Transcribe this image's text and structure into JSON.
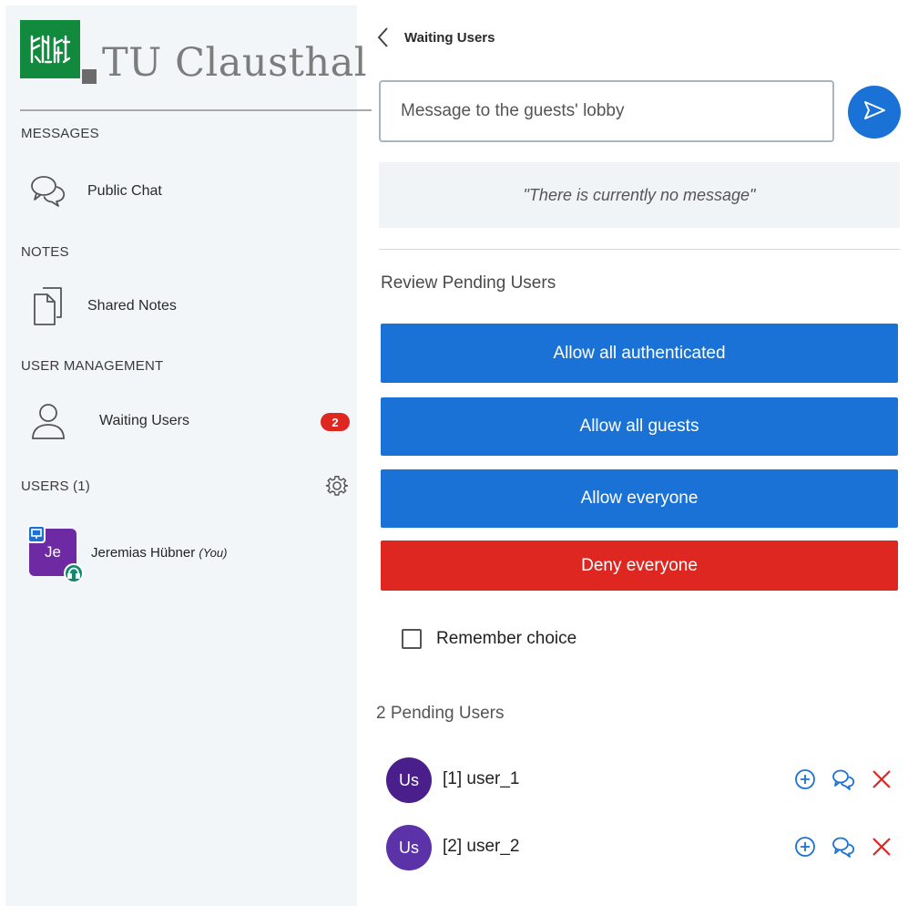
{
  "brand": {
    "name": "TU Clausthal",
    "logo_icon": "university-crest-icon",
    "color": "#118a3d"
  },
  "sidebar": {
    "messages": {
      "heading": "MESSAGES",
      "items": [
        {
          "label": "Public Chat",
          "icon": "chat-icon"
        }
      ]
    },
    "notes": {
      "heading": "NOTES",
      "items": [
        {
          "label": "Shared Notes",
          "icon": "notes-icon"
        }
      ]
    },
    "user_management": {
      "heading": "USER MANAGEMENT",
      "items": [
        {
          "label": "Waiting Users",
          "icon": "user-icon",
          "badge": "2"
        }
      ]
    },
    "users": {
      "heading": "USERS (1)",
      "settings_icon": "gear-icon"
    },
    "current_user": {
      "initials": "Je",
      "name": "Jeremias Hübner",
      "suffix": "(You)",
      "avatar_color": "#6d2aa2"
    }
  },
  "panel": {
    "title": "Waiting Users",
    "back_icon": "chevron-left-icon",
    "message_input": {
      "placeholder": "Message to the guests' lobby",
      "value": ""
    },
    "send_icon": "send-icon",
    "lobby_message": "\"There is currently no message\"",
    "review_heading": "Review Pending Users",
    "buttons": {
      "allow_authenticated": "Allow all authenticated",
      "allow_guests": "Allow all guests",
      "allow_everyone": "Allow everyone",
      "deny_everyone": "Deny everyone"
    },
    "remember_choice": {
      "label": "Remember choice",
      "checked": false
    },
    "pending_heading": "2 Pending Users",
    "pending_users": [
      {
        "initials": "Us",
        "label": "[1] user_1",
        "avatar_color": "#4a1f8c"
      },
      {
        "initials": "Us",
        "label": "[2] user_2",
        "avatar_color": "#5b32a8"
      }
    ]
  },
  "colors": {
    "primary": "#1b72d6",
    "danger": "#df2721",
    "sidebar_bg": "#f3f6f9"
  }
}
